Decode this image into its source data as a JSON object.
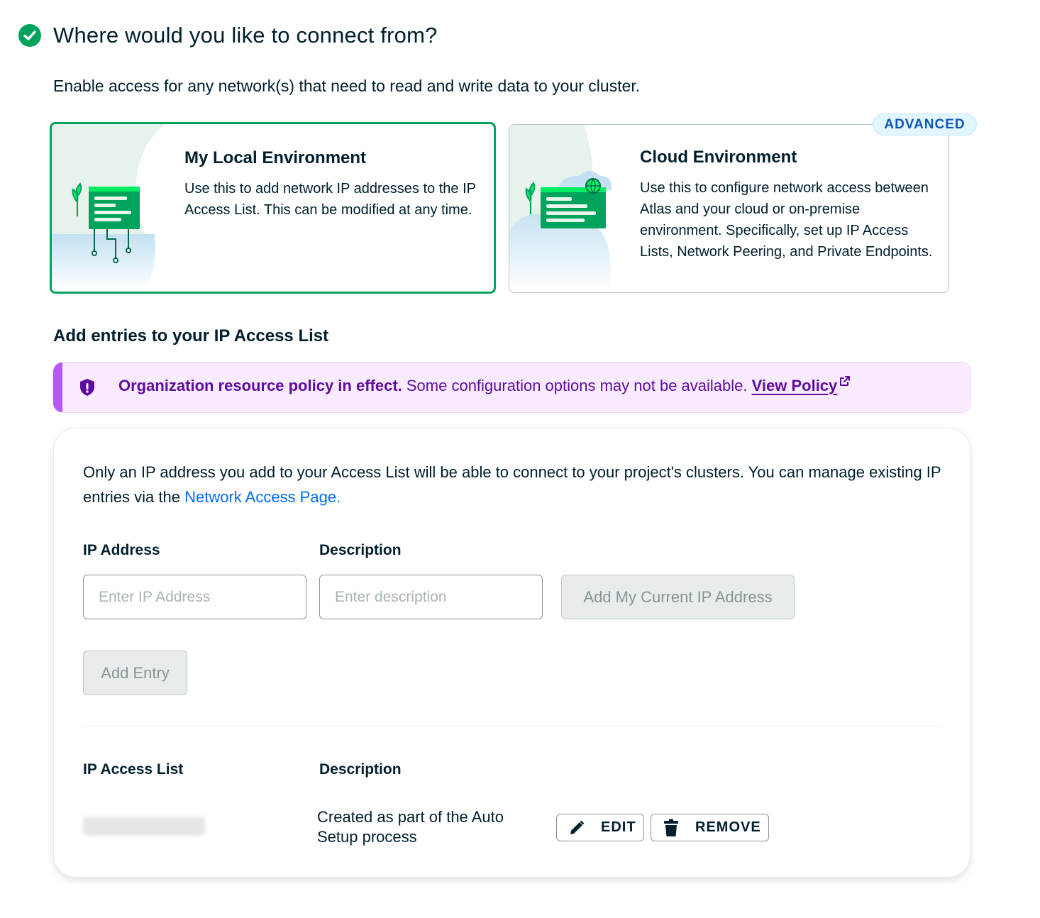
{
  "header": {
    "title": "Where would you like to connect from?",
    "subtitle": "Enable access for any network(s) that need to read and write data to your cluster."
  },
  "environments": {
    "local": {
      "title": "My Local Environment",
      "description": "Use this to add network IP addresses to the IP Access List. This can be modified at any time.",
      "selected": true
    },
    "cloud": {
      "badge": "ADVANCED",
      "title": "Cloud Environment",
      "description": "Use this to configure network access between Atlas and your cloud or on-premise environment. Specifically, set up IP Access Lists, Network Peering, and Private Endpoints.",
      "selected": false
    }
  },
  "access_section": {
    "heading": "Add entries to your IP Access List",
    "policy_banner": {
      "strong": "Organization resource policy in effect.",
      "text": " Some configuration options may not be available. ",
      "link": "View Policy"
    },
    "intro_text": "Only an IP address you add to your Access List will be able to connect to your project's clusters. You can manage existing IP entries via the ",
    "intro_link": "Network Access Page.",
    "form": {
      "ip_label": "IP Address",
      "ip_placeholder": "Enter IP Address",
      "desc_label": "Description",
      "desc_placeholder": "Enter description",
      "add_current_ip_button": "Add My Current IP Address",
      "add_entry_button": "Add Entry"
    },
    "list": {
      "col_ip": "IP Access List",
      "col_desc": "Description",
      "rows": [
        {
          "description": "Created as part of the Auto Setup process",
          "edit_label": "EDIT",
          "remove_label": "REMOVE"
        }
      ]
    }
  },
  "colors": {
    "success_green": "#00a35c",
    "link_blue": "#016bf8",
    "policy_purple": "#5e0c9e",
    "badge_blue": "#1254b7"
  },
  "icons": [
    "check-circle-icon",
    "shield-icon",
    "external-link-icon",
    "pencil-icon",
    "trash-icon"
  ]
}
